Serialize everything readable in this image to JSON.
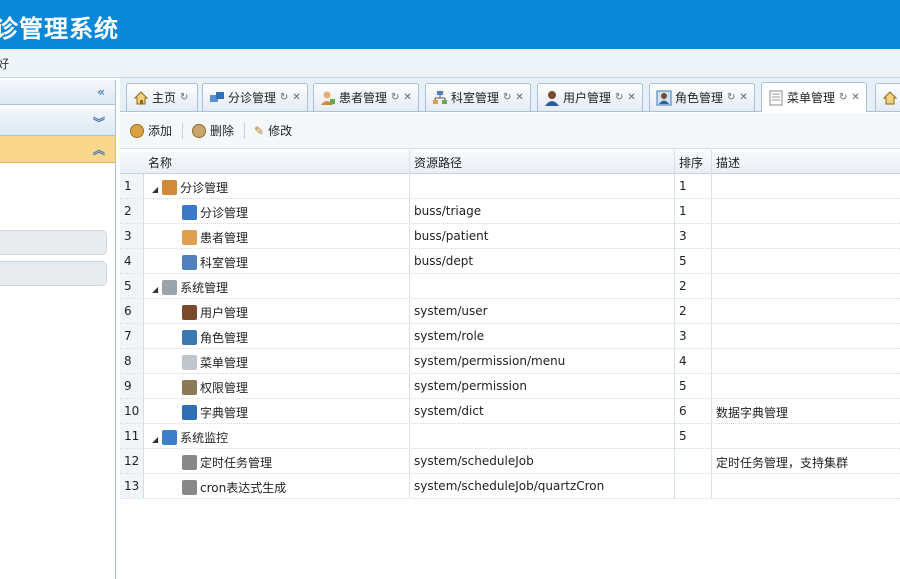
{
  "app": {
    "title": "诊管理系统",
    "welcome": "好"
  },
  "tabs": [
    {
      "label": "主页",
      "icon": "home-icon",
      "closable": false
    },
    {
      "label": "分诊管理",
      "icon": "triage-icon",
      "closable": true
    },
    {
      "label": "患者管理",
      "icon": "patient-icon",
      "closable": true
    },
    {
      "label": "科室管理",
      "icon": "dept-icon",
      "closable": true
    },
    {
      "label": "用户管理",
      "icon": "user-icon",
      "closable": true
    },
    {
      "label": "角色管理",
      "icon": "role-icon",
      "closable": true
    },
    {
      "label": "菜单管理",
      "icon": "menu-icon",
      "closable": true,
      "selected": true
    }
  ],
  "toolbar": {
    "add_label": "添加",
    "delete_label": "删除",
    "edit_label": "修改"
  },
  "table": {
    "headers": [
      "名称",
      "资源路径",
      "排序",
      "描述"
    ],
    "rows": [
      {
        "num": "1",
        "name": "分诊管理",
        "path": "",
        "order": "1",
        "desc": "",
        "icon": "group-icon",
        "level": 0
      },
      {
        "num": "2",
        "name": "分诊管理",
        "path": "buss/triage",
        "order": "1",
        "desc": "",
        "icon": "triage-icon",
        "level": 1
      },
      {
        "num": "3",
        "name": "患者管理",
        "path": "buss/patient",
        "order": "3",
        "desc": "",
        "icon": "patient-icon",
        "level": 1
      },
      {
        "num": "4",
        "name": "科室管理",
        "path": "buss/dept",
        "order": "5",
        "desc": "",
        "icon": "dept-icon",
        "level": 1
      },
      {
        "num": "5",
        "name": "系统管理",
        "path": "",
        "order": "2",
        "desc": "",
        "icon": "gear-icon",
        "level": 0
      },
      {
        "num": "6",
        "name": "用户管理",
        "path": "system/user",
        "order": "2",
        "desc": "",
        "icon": "user-icon",
        "level": 1
      },
      {
        "num": "7",
        "name": "角色管理",
        "path": "system/role",
        "order": "3",
        "desc": "",
        "icon": "role-icon",
        "level": 1
      },
      {
        "num": "8",
        "name": "菜单管理",
        "path": "system/permission/menu",
        "order": "4",
        "desc": "",
        "icon": "menu-icon",
        "level": 1
      },
      {
        "num": "9",
        "name": "权限管理",
        "path": "system/permission",
        "order": "5",
        "desc": "",
        "icon": "lock-icon",
        "level": 1
      },
      {
        "num": "10",
        "name": "字典管理",
        "path": "system/dict",
        "order": "6",
        "desc": "数据字典管理",
        "icon": "dict-icon",
        "level": 1
      },
      {
        "num": "11",
        "name": "系统监控",
        "path": "",
        "order": "5",
        "desc": "",
        "icon": "monitor-icon",
        "level": 0
      },
      {
        "num": "12",
        "name": "定时任务管理",
        "path": "system/scheduleJob",
        "order": "",
        "desc": "定时任务管理，支持集群",
        "icon": "clock-icon",
        "level": 1
      },
      {
        "num": "13",
        "name": "cron表达式生成",
        "path": "system/scheduleJob/quartzCron",
        "order": "",
        "desc": "",
        "icon": "cron-icon",
        "level": 1
      }
    ]
  },
  "colors": {
    "topbar": "#0a87d6",
    "active_menu": "#fbd78c"
  }
}
